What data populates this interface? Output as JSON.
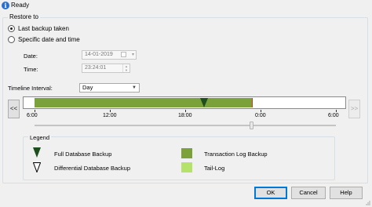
{
  "status": {
    "icon": "info-icon",
    "text": "Ready"
  },
  "restore_to": {
    "title": "Restore to",
    "options": [
      {
        "label": "Last backup taken",
        "checked": true
      },
      {
        "label": "Specific date and time",
        "checked": false
      }
    ],
    "date": {
      "label": "Date:",
      "value": "14-01-2019"
    },
    "time": {
      "label": "Time:",
      "value": "23:24:01"
    },
    "timeline_interval": {
      "label": "Timeline Interval:",
      "value": "Day"
    }
  },
  "timeline": {
    "prev": "<<",
    "next": ">>",
    "ticks": [
      "6:00",
      "12:00",
      "18:00",
      "0:00",
      "6:00"
    ],
    "full_backup_fraction": 0.5,
    "colors": {
      "log": "#7ba13b",
      "full_backup": "#1e4d1e",
      "end_marker": "#c0392b"
    }
  },
  "legend": {
    "title": "Legend",
    "items": [
      {
        "icon": "full-backup-marker-icon",
        "label": "Full Database Backup"
      },
      {
        "icon": "differential-backup-marker-icon",
        "label": "Differential Database Backup"
      },
      {
        "icon": "transaction-log-swatch",
        "label": "Transaction Log Backup",
        "color": "#7ba13b"
      },
      {
        "icon": "tail-log-swatch",
        "label": "Tail-Log",
        "color": "#b5e36a"
      }
    ]
  },
  "buttons": {
    "ok": "OK",
    "cancel": "Cancel",
    "help": "Help"
  }
}
